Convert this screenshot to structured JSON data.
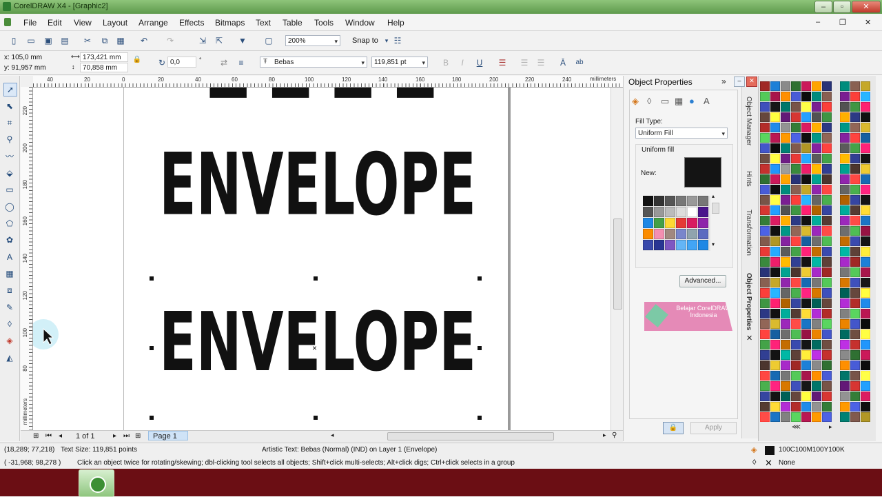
{
  "window": {
    "title": "CorelDRAW X4 - [Graphic2]"
  },
  "menu": [
    "File",
    "Edit",
    "View",
    "Layout",
    "Arrange",
    "Effects",
    "Bitmaps",
    "Text",
    "Table",
    "Tools",
    "Window",
    "Help"
  ],
  "standard_toolbar": {
    "zoom": "200%",
    "snap_to": "Snap to"
  },
  "property_bar": {
    "x": "x: 105,0 mm",
    "y": "y: 91,957 mm",
    "width": "173,421 mm",
    "height": "70,858 mm",
    "rotation": "0,0",
    "font": "Bebas",
    "font_size": "119,851 pt"
  },
  "rulers": {
    "units": "millimeters",
    "h_ticks": [
      "40",
      "20",
      "0",
      "20",
      "40",
      "60",
      "80",
      "100",
      "120",
      "140",
      "160",
      "180",
      "200",
      "220",
      "240"
    ],
    "v_ticks": [
      "220",
      "200",
      "180",
      "160",
      "140",
      "120",
      "100",
      "80"
    ],
    "v_units": "millimeters"
  },
  "canvas": {
    "text_top": "ENVELOPE",
    "text_bottom": "ENVELOPE"
  },
  "page_nav": {
    "count": "1 of 1",
    "page_tab": "Page 1"
  },
  "docker": {
    "title": "Object Properties",
    "fill_type_label": "Fill Type:",
    "fill_type_value": "Uniform Fill",
    "uniform_label": "Uniform fill",
    "new_label": "New:",
    "new_color": "#141414",
    "advanced_button": "Advanced...",
    "apply_button": "Apply",
    "banner_text": "Belajar CorelDRAW Indonesia",
    "side_tabs": [
      "Object Manager",
      "Hints",
      "Transformation",
      "Object Properties"
    ]
  },
  "status": {
    "coords": "(18,289; 77,218)",
    "text_size": "Text Size: 119,851 points",
    "object_info": "Artistic Text: Bebas (Normal) (IND) on Layer 1  (Envelope)",
    "coords2": "( -31,968; 98,278 )",
    "hint": "Click an object twice for rotating/skewing; dbl-clicking tool selects all objects; Shift+click multi-selects; Alt+click digs; Ctrl+click selects in a group",
    "fill_label": "100C100M100Y100K",
    "outline_label": "None"
  },
  "colors": {
    "accent": "#5e9a4c",
    "taskbar": "#6b0e14",
    "page_tab": "#cfe3f7",
    "banner": "#e58ab7"
  },
  "icons": [
    "new-doc-icon",
    "open-icon",
    "save-icon",
    "print-icon",
    "cut-icon",
    "copy-icon",
    "paste-icon",
    "undo-icon",
    "redo-icon",
    "import-icon",
    "export-icon",
    "pick-tool-icon",
    "shape-tool-icon",
    "crop-tool-icon",
    "zoom-tool-icon",
    "freehand-tool-icon",
    "rectangle-tool-icon",
    "ellipse-tool-icon",
    "text-tool-icon",
    "table-tool-icon",
    "eyedropper-tool-icon",
    "fill-tool-icon",
    "lock-icon",
    "mouse-cursor-icon"
  ]
}
